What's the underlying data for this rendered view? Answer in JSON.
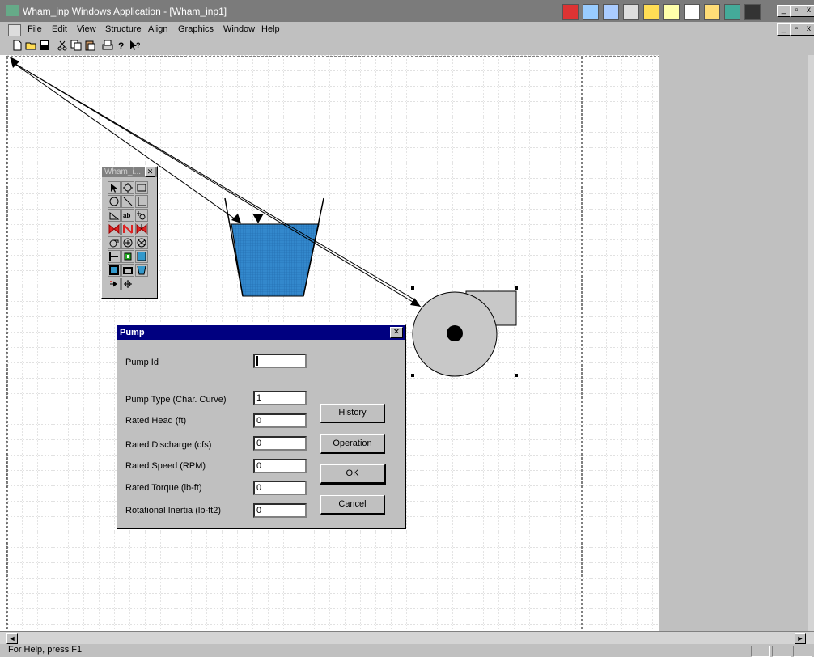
{
  "window": {
    "title": "Wham_inp Windows Application - [Wham_inp1]",
    "min_glyph": "_",
    "max_glyph": "▫",
    "close_glyph": "x"
  },
  "menu": [
    "File",
    "Edit",
    "View",
    "Structure",
    "Align",
    "Graphics",
    "Window",
    "Help"
  ],
  "toolbar": [
    "new-file",
    "open-folder",
    "save-disk",
    "cut-scissors",
    "copy",
    "paste",
    "print",
    "help",
    "context-help"
  ],
  "palette": {
    "title": "Wham_i...",
    "close_glyph": "✕",
    "tools": [
      "arrow",
      "circle-node",
      "rectangle",
      "circle",
      "line",
      "corner-line",
      "slope",
      "text-ab",
      "junction",
      "valve-red",
      "check-valve-red",
      "gate-valve-red",
      "pump",
      "pump-2",
      "fan",
      "dead-end",
      "green-device",
      "blue-tank",
      "blue-box",
      "reservoir",
      "open-tank",
      "special",
      "crosshair"
    ]
  },
  "dialog": {
    "title": "Pump",
    "close_glyph": "✕",
    "fields": [
      {
        "label": "Pump Id",
        "value": ""
      },
      {
        "label": "Pump Type (Char. Curve)",
        "value": "1"
      },
      {
        "label": "Rated Head (ft)",
        "value": "0"
      },
      {
        "label": "Rated Discharge (cfs)",
        "value": "0"
      },
      {
        "label": "Rated Speed (RPM)",
        "value": "0"
      },
      {
        "label": "Rated Torque (lb-ft)",
        "value": "0"
      },
      {
        "label": "Rotational Inertia (lb-ft2)",
        "value": "0"
      }
    ],
    "buttons": {
      "history": "History",
      "operation": "Operation",
      "ok": "OK",
      "cancel": "Cancel"
    }
  },
  "status": {
    "text": "For Help, press F1"
  },
  "colors": {
    "grid": "#b0b0b0",
    "water": "#3388cc",
    "pump": "#c8c8c8",
    "dialog_title": "#000080"
  }
}
